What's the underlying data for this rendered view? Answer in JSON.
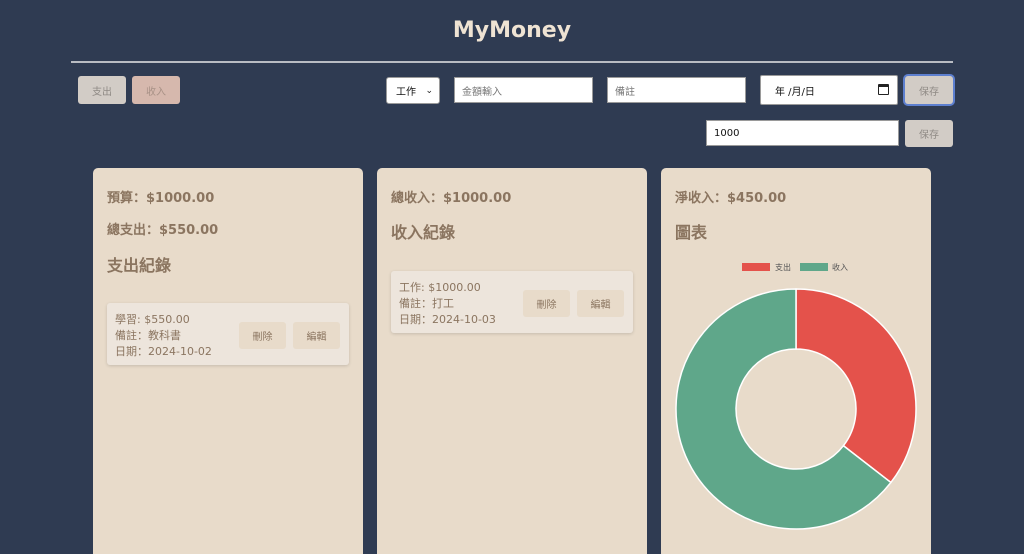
{
  "app": {
    "title": "MyMoney"
  },
  "toolbar": {
    "expense_tab": "支出",
    "income_tab": "收入",
    "category_selected": "工作",
    "amount_placeholder": "金額輸入",
    "note_placeholder": "備註",
    "date_placeholder": "年 /月/日",
    "save_label": "保存",
    "budget_value": "1000",
    "budget_save_label": "保存"
  },
  "expense_panel": {
    "budget": "預算：$1000.00",
    "total_expense": "總支出：$550.00",
    "heading": "支出紀錄",
    "records": [
      {
        "line1": "學習: $550.00",
        "line2": "備註：教科書",
        "line3": "日期：2024-10-02",
        "delete": "刪除",
        "edit": "編輯"
      }
    ]
  },
  "income_panel": {
    "total_income": "總收入：$1000.00",
    "heading": "收入紀錄",
    "records": [
      {
        "line1": "工作: $1000.00",
        "line2": "備註：打工",
        "line3": "日期：2024-10-03",
        "delete": "刪除",
        "edit": "編輯"
      }
    ]
  },
  "chart_panel": {
    "net_income": "淨收入：$450.00",
    "heading": "圖表"
  },
  "chart_data": {
    "type": "pie",
    "categories": [
      "支出",
      "收入"
    ],
    "values": [
      550,
      1000
    ],
    "colors": [
      "#e4524b",
      "#5fa78a"
    ],
    "legend": "top",
    "donut": true
  }
}
